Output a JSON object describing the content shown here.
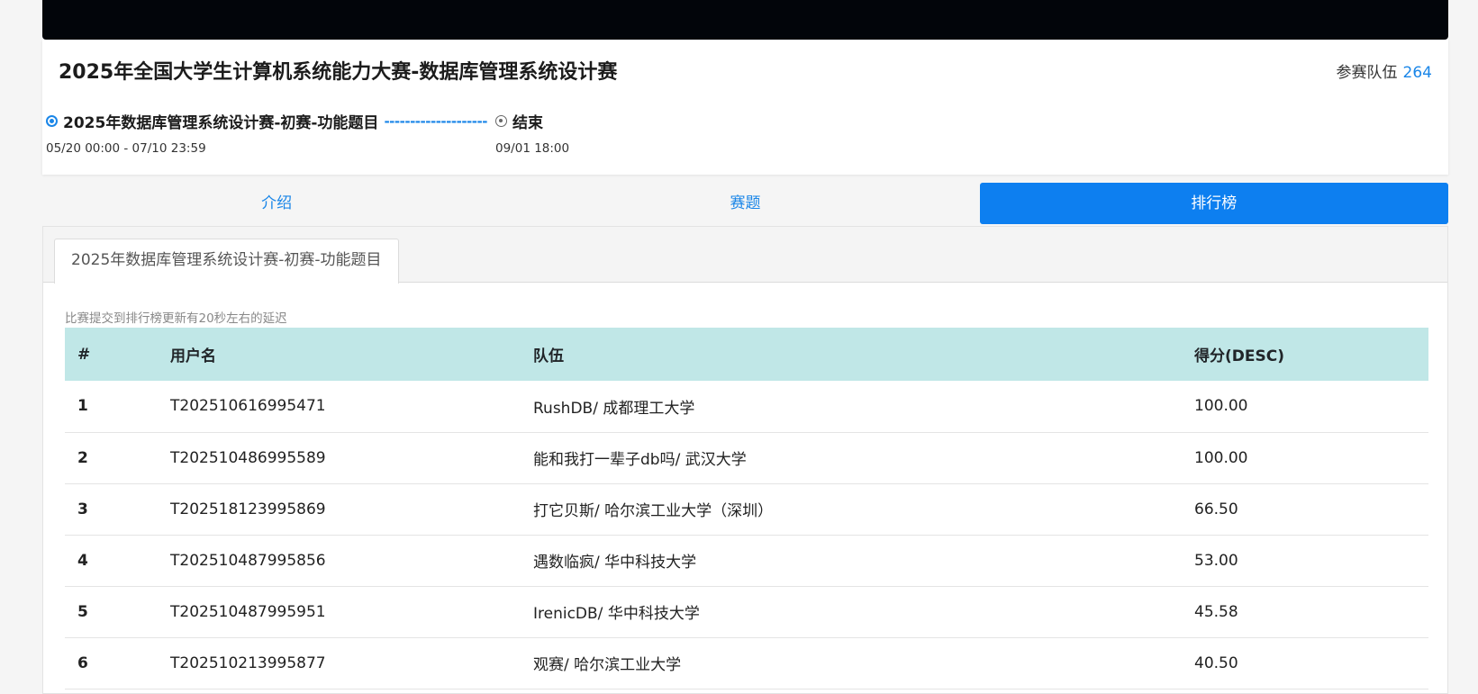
{
  "contest": {
    "title": "2025年全国大学生计算机系统能力大赛-数据库管理系统设计赛",
    "team_count_label": "参赛队伍",
    "team_count": "264"
  },
  "timeline": {
    "stage1": {
      "name": "2025年数据库管理系统设计赛-初赛-功能题目",
      "dash": "--------------------",
      "time": "05/20 00:00 - 07/10 23:59"
    },
    "stage2": {
      "name": "结束",
      "time": "09/01 18:00"
    }
  },
  "tabs": {
    "intro": "介绍",
    "problems": "赛题",
    "leaderboard": "排行榜"
  },
  "subtab": "2025年数据库管理系统设计赛-初赛-功能题目",
  "note": "比赛提交到排行榜更新有20秒左右的延迟",
  "table": {
    "headers": [
      "#",
      "用户名",
      "队伍",
      "得分(DESC)"
    ],
    "rows": [
      [
        "1",
        "T202510616995471",
        "RushDB/ 成都理工大学",
        "100.00"
      ],
      [
        "2",
        "T202510486995589",
        "能和我打一辈子db吗/ 武汉大学",
        "100.00"
      ],
      [
        "3",
        "T202518123995869",
        "打它贝斯/ 哈尔滨工业大学（深圳）",
        "66.50"
      ],
      [
        "4",
        "T202510487995856",
        "遇数临疯/ 华中科技大学",
        "53.00"
      ],
      [
        "5",
        "T202510487995951",
        "IrenicDB/ 华中科技大学",
        "45.58"
      ],
      [
        "6",
        "T202510213995877",
        "观赛/ 哈尔滨工业大学",
        "40.50"
      ]
    ]
  },
  "colors": {
    "accent": "#1a86e8",
    "active_tab": "#0d7ff0",
    "table_header": "#c0e7e7"
  }
}
